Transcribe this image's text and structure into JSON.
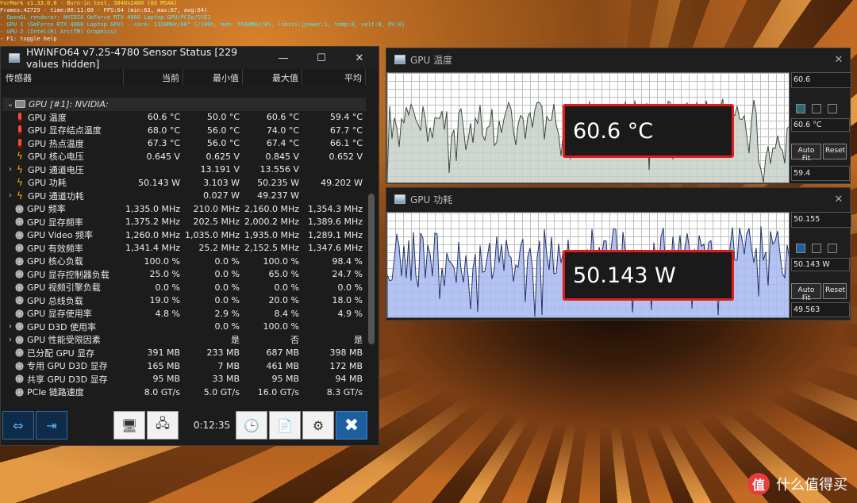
{
  "furmark": {
    "line1": "FurMark v1.33.0.0 - Burn-in test, 3840x2400 (8X MSAA)",
    "line2": "Frames:42729 - time:00:11:09 - FPS:64 (min:63, max:67, avg:64)",
    "line3": "- OpenGL renderer: NVIDIA GeForce RTX 4060 Laptop GPU/PCIe/SSE2",
    "line4": "- GPU 1 (GeForce RTX 4060 Laptop GPU) - core: 1320MHz/60° C/100%, mem: 5500MHz/4%, limits:[power:1, temp:0, volt:0, OV:0]",
    "line5": "- GPU 2 (Intel(R) Arc(TM) Graphics)",
    "line6": "- F1: toggle help"
  },
  "hwinfo": {
    "title": "HWiNFO64 v7.25-4780 Sensor Status [229 values hidden]",
    "minimize": "—",
    "maximize": "☐",
    "close": "✕",
    "columns": {
      "name": "传感器",
      "current": "当前",
      "min": "最小值",
      "max": "最大值",
      "avg": "平均"
    },
    "group": "GPU [#1]: NVIDIA:",
    "rows": [
      {
        "name": "GPU 温度",
        "cur": "60.6 °C",
        "min": "50.0 °C",
        "max": "60.6 °C",
        "avg": "59.4 °C",
        "icon": "thermometer-icon"
      },
      {
        "name": "GPU 显存结点温度",
        "cur": "68.0 °C",
        "min": "56.0 °C",
        "max": "74.0 °C",
        "avg": "67.7 °C",
        "icon": "thermometer-icon"
      },
      {
        "name": "GPU 热点温度",
        "cur": "67.3 °C",
        "min": "56.0 °C",
        "max": "67.4 °C",
        "avg": "66.1 °C",
        "icon": "thermometer-icon"
      },
      {
        "name": "GPU 核心电压",
        "cur": "0.645 V",
        "min": "0.625 V",
        "max": "0.845 V",
        "avg": "0.652 V",
        "icon": "voltage-icon"
      },
      {
        "name": "GPU 通道电压",
        "cur": "",
        "min": "13.191 V",
        "max": "13.556 V",
        "avg": "",
        "icon": "voltage-icon",
        "expand": true
      },
      {
        "name": "GPU 功耗",
        "cur": "50.143 W",
        "min": "3.103 W",
        "max": "50.235 W",
        "avg": "49.202 W",
        "icon": "power-icon"
      },
      {
        "name": "GPU 通道功耗",
        "cur": "",
        "min": "0.027 W",
        "max": "49.237 W",
        "avg": "",
        "icon": "power-icon",
        "expand": true
      },
      {
        "name": "GPU 频率",
        "cur": "1,335.0 MHz",
        "min": "210.0 MHz",
        "max": "2,160.0 MHz",
        "avg": "1,354.3 MHz",
        "icon": "clock-icon"
      },
      {
        "name": "GPU 显存频率",
        "cur": "1,375.2 MHz",
        "min": "202.5 MHz",
        "max": "2,000.2 MHz",
        "avg": "1,389.6 MHz",
        "icon": "clock-icon"
      },
      {
        "name": "GPU Video 频率",
        "cur": "1,260.0 MHz",
        "min": "1,035.0 MHz",
        "max": "1,935.0 MHz",
        "avg": "1,289.1 MHz",
        "icon": "clock-icon"
      },
      {
        "name": "GPU 有效频率",
        "cur": "1,341.4 MHz",
        "min": "25.2 MHz",
        "max": "2,152.5 MHz",
        "avg": "1,347.6 MHz",
        "icon": "clock-icon"
      },
      {
        "name": "GPU 核心负载",
        "cur": "100.0 %",
        "min": "0.0 %",
        "max": "100.0 %",
        "avg": "98.4 %",
        "icon": "clock-icon"
      },
      {
        "name": "GPU 显存控制器负载",
        "cur": "25.0 %",
        "min": "0.0 %",
        "max": "65.0 %",
        "avg": "24.7 %",
        "icon": "clock-icon"
      },
      {
        "name": "GPU 视频引擎负载",
        "cur": "0.0 %",
        "min": "0.0 %",
        "max": "0.0 %",
        "avg": "0.0 %",
        "icon": "clock-icon"
      },
      {
        "name": "GPU 总线负载",
        "cur": "19.0 %",
        "min": "0.0 %",
        "max": "20.0 %",
        "avg": "18.0 %",
        "icon": "clock-icon"
      },
      {
        "name": "GPU 显存使用率",
        "cur": "4.8 %",
        "min": "2.9 %",
        "max": "8.4 %",
        "avg": "4.9 %",
        "icon": "clock-icon"
      },
      {
        "name": "GPU D3D 使用率",
        "cur": "",
        "min": "0.0 %",
        "max": "100.0 %",
        "avg": "",
        "icon": "clock-icon",
        "expand": true
      },
      {
        "name": "GPU 性能受限因素",
        "cur": "",
        "min": "是",
        "max": "否",
        "avg": "是",
        "avg2": "是",
        "icon": "clock-icon",
        "expand": true
      },
      {
        "name": "已分配 GPU 显存",
        "cur": "391 MB",
        "min": "233 MB",
        "max": "687 MB",
        "avg": "398 MB",
        "icon": "clock-icon"
      },
      {
        "name": "专用 GPU D3D 显存",
        "cur": "165 MB",
        "min": "7 MB",
        "max": "461 MB",
        "avg": "172 MB",
        "icon": "clock-icon"
      },
      {
        "name": "共享 GPU D3D 显存",
        "cur": "95 MB",
        "min": "33 MB",
        "max": "95 MB",
        "avg": "94 MB",
        "icon": "clock-icon"
      },
      {
        "name": "PCIe 链路速度",
        "cur": "8.0 GT/s",
        "min": "5.0 GT/s",
        "max": "16.0 GT/s",
        "avg": "8.3 GT/s",
        "icon": "clock-icon"
      }
    ],
    "uptime": "0:12:35"
  },
  "temp_graph": {
    "title": "GPU 温度",
    "top_value": "60.6",
    "current_value": "60.6 °C",
    "bottom_value": "59.4",
    "big_readout": "60.6 °C",
    "autofit": "Auto Fit",
    "reset": "Reset",
    "fill": "#c8d0c8",
    "line": "#3a4a3a"
  },
  "power_graph": {
    "title": "GPU 功耗",
    "top_value": "50.155",
    "current_value": "50.143 W",
    "bottom_value": "49.563",
    "big_readout": "50.143 W",
    "autofit": "Auto Fit",
    "reset": "Reset",
    "fill": "#a8b8f0",
    "line": "#223366"
  },
  "watermark": {
    "logo_char": "值",
    "text": "什么值得买"
  }
}
